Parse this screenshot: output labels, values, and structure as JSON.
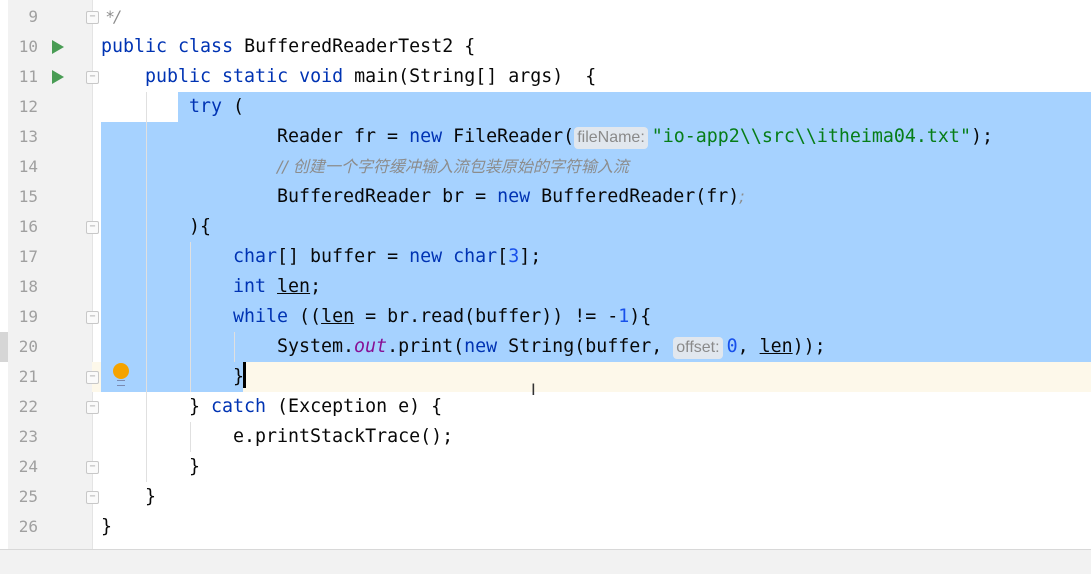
{
  "editor": {
    "colors": {
      "selection": "#a6d2ff",
      "keyword": "#0033b3",
      "string": "#067d17",
      "comment": "#8c8c8c",
      "run_icon": "#499c54",
      "intention_bulb": "#f5a300"
    },
    "run_lines": [
      10,
      11
    ],
    "fold_lines": [
      9,
      11,
      16,
      19,
      21,
      22,
      24,
      25
    ],
    "caret_line": 21,
    "lines": [
      {
        "n": "9",
        "indent": 0,
        "tokens": [
          [
            " */",
            "cm"
          ]
        ]
      },
      {
        "n": "10",
        "indent": 0,
        "tokens": [
          [
            "public class",
            "kw"
          ],
          [
            " BufferedReaderTest2 {",
            ""
          ]
        ]
      },
      {
        "n": "11",
        "indent": 4,
        "tokens": [
          [
            "public static void",
            "kw"
          ],
          [
            " main(String[] args)  {",
            ""
          ]
        ]
      },
      {
        "n": "12",
        "indent": 8,
        "tokens": [
          [
            "try",
            "kw"
          ],
          [
            " (",
            ""
          ]
        ]
      },
      {
        "n": "13",
        "indent": 16,
        "tokens": [
          [
            "Reader fr = ",
            ""
          ],
          [
            "new",
            "kw"
          ],
          [
            " FileReader(",
            ""
          ],
          [
            "fileName:",
            "hint"
          ],
          [
            "\"io-app2\\\\src\\\\itheima04.txt\"",
            "str"
          ],
          [
            ");",
            ""
          ]
        ]
      },
      {
        "n": "14",
        "indent": 16,
        "tokens": [
          [
            "// 创建一个字符缓冲输入流包装原始的字符输入流",
            "cm"
          ]
        ]
      },
      {
        "n": "15",
        "indent": 16,
        "tokens": [
          [
            "BufferedReader br = ",
            ""
          ],
          [
            "new",
            "kw"
          ],
          [
            " BufferedReader(fr)",
            ""
          ],
          [
            ";",
            "cm"
          ]
        ]
      },
      {
        "n": "16",
        "indent": 8,
        "tokens": [
          [
            "){",
            ""
          ]
        ]
      },
      {
        "n": "17",
        "indent": 12,
        "tokens": [
          [
            "char",
            "kw"
          ],
          [
            "[] buffer = ",
            ""
          ],
          [
            "new char",
            "kw"
          ],
          [
            "[",
            ""
          ],
          [
            "3",
            "num"
          ],
          [
            "];",
            ""
          ]
        ]
      },
      {
        "n": "18",
        "indent": 12,
        "tokens": [
          [
            "int",
            "kw"
          ],
          [
            " ",
            ""
          ],
          [
            "len",
            "ul"
          ],
          [
            ";",
            ""
          ]
        ]
      },
      {
        "n": "19",
        "indent": 12,
        "tokens": [
          [
            "while",
            "kw"
          ],
          [
            " ((",
            ""
          ],
          [
            "len",
            "ul"
          ],
          [
            " = br.read(buffer)) != -",
            ""
          ],
          [
            "1",
            "num"
          ],
          [
            "){",
            ""
          ]
        ]
      },
      {
        "n": "20",
        "indent": 16,
        "tokens": [
          [
            "System.",
            ""
          ],
          [
            "out",
            "fld"
          ],
          [
            ".print(",
            ""
          ],
          [
            "new",
            "kw"
          ],
          [
            " String(buffer, ",
            ""
          ],
          [
            "offset:",
            "hint"
          ],
          [
            "0",
            "num"
          ],
          [
            ", ",
            ""
          ],
          [
            "len",
            "ul"
          ],
          [
            "));",
            ""
          ]
        ]
      },
      {
        "n": "21",
        "indent": 12,
        "tokens": [
          [
            "}",
            ""
          ]
        ]
      },
      {
        "n": "22",
        "indent": 8,
        "tokens": [
          [
            "} ",
            ""
          ],
          [
            "catch",
            "kw"
          ],
          [
            " (Exception e) {",
            ""
          ]
        ]
      },
      {
        "n": "23",
        "indent": 12,
        "tokens": [
          [
            "e.printStackTrace();",
            ""
          ]
        ]
      },
      {
        "n": "24",
        "indent": 8,
        "tokens": [
          [
            "}",
            ""
          ]
        ]
      },
      {
        "n": "25",
        "indent": 4,
        "tokens": [
          [
            "}",
            ""
          ]
        ]
      },
      {
        "n": "26",
        "indent": 0,
        "tokens": [
          [
            "}",
            ""
          ]
        ]
      }
    ]
  }
}
